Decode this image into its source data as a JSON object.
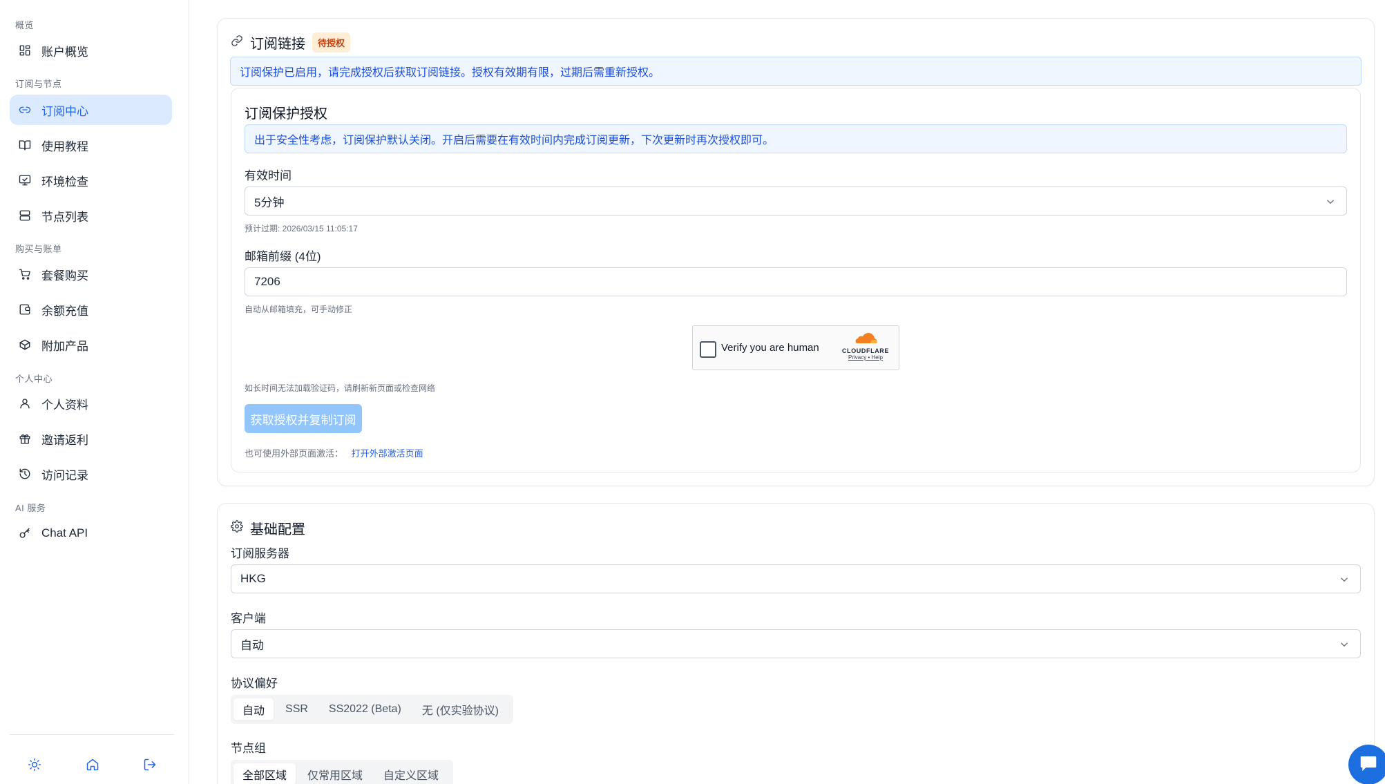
{
  "sidebar": {
    "groups": [
      {
        "label": "概览"
      },
      {
        "label": "订阅与节点"
      },
      {
        "label": "购买与账单"
      },
      {
        "label": "个人中心"
      },
      {
        "label": "AI 服务"
      }
    ],
    "items": [
      {
        "label": "账户概览",
        "icon": "dashboard-icon"
      },
      {
        "label": "订阅中心",
        "icon": "link-icon",
        "active": true
      },
      {
        "label": "使用教程",
        "icon": "book-icon"
      },
      {
        "label": "环境检查",
        "icon": "monitor-check-icon"
      },
      {
        "label": "节点列表",
        "icon": "server-icon"
      },
      {
        "label": "套餐购买",
        "icon": "cart-icon"
      },
      {
        "label": "余额充值",
        "icon": "wallet-icon"
      },
      {
        "label": "附加产品",
        "icon": "package-icon"
      },
      {
        "label": "个人资料",
        "icon": "user-icon"
      },
      {
        "label": "邀请返利",
        "icon": "gift-icon"
      },
      {
        "label": "访问记录",
        "icon": "history-icon"
      },
      {
        "label": "Chat API",
        "icon": "key-icon"
      }
    ],
    "footer": [
      "sun-icon",
      "home-icon",
      "logout-icon"
    ]
  },
  "subscription": {
    "title": "订阅链接",
    "badge": "待授权",
    "notice": "订阅保护已启用，请完成授权后获取订阅链接。授权有效期有限，过期后需重新授权。",
    "auth": {
      "title": "订阅保护授权",
      "notice": "出于安全性考虑，订阅保护默认关闭。开启后需要在有效时间内完成订阅更新，下次更新时再次授权即可。",
      "valid_label": "有效时间",
      "valid_value": "5分钟",
      "expiry_hint": "预计过期: 2026/03/15 11:05:17",
      "email_label": "邮箱前缀 (4位)",
      "email_value": "7206",
      "email_hint": "自动从邮箱填充，可手动修正",
      "captcha_text": "Verify you are human",
      "captcha_brand": "CLOUDFLARE",
      "captcha_privacy": "Privacy",
      "captcha_sep": "•",
      "captcha_help": "Help",
      "captcha_hint": "如长时间无法加载验证码，请刷新新页面或检查网络",
      "submit_label": "获取授权并复制订阅",
      "external_text": "也可使用外部页面激活：",
      "external_link": "打开外部激活页面"
    }
  },
  "basic": {
    "title": "基础配置",
    "server_label": "订阅服务器",
    "server_value": "HKG",
    "client_label": "客户端",
    "client_value": "自动",
    "protocol_label": "协议偏好",
    "protocol_options": [
      "自动",
      "SSR",
      "SS2022 (Beta)",
      "无 (仅实验协议)"
    ],
    "protocol_selected": 0,
    "group_label": "节点组",
    "group_options": [
      "全部区域",
      "仅常用区域",
      "自定义区域"
    ],
    "group_selected": 0
  },
  "colors": {
    "accent": "#2563eb",
    "active_bg": "#dbeafe",
    "badge_bg": "#ffedd5",
    "badge_text": "#c2410c",
    "button_disabled": "#93c5fd"
  }
}
